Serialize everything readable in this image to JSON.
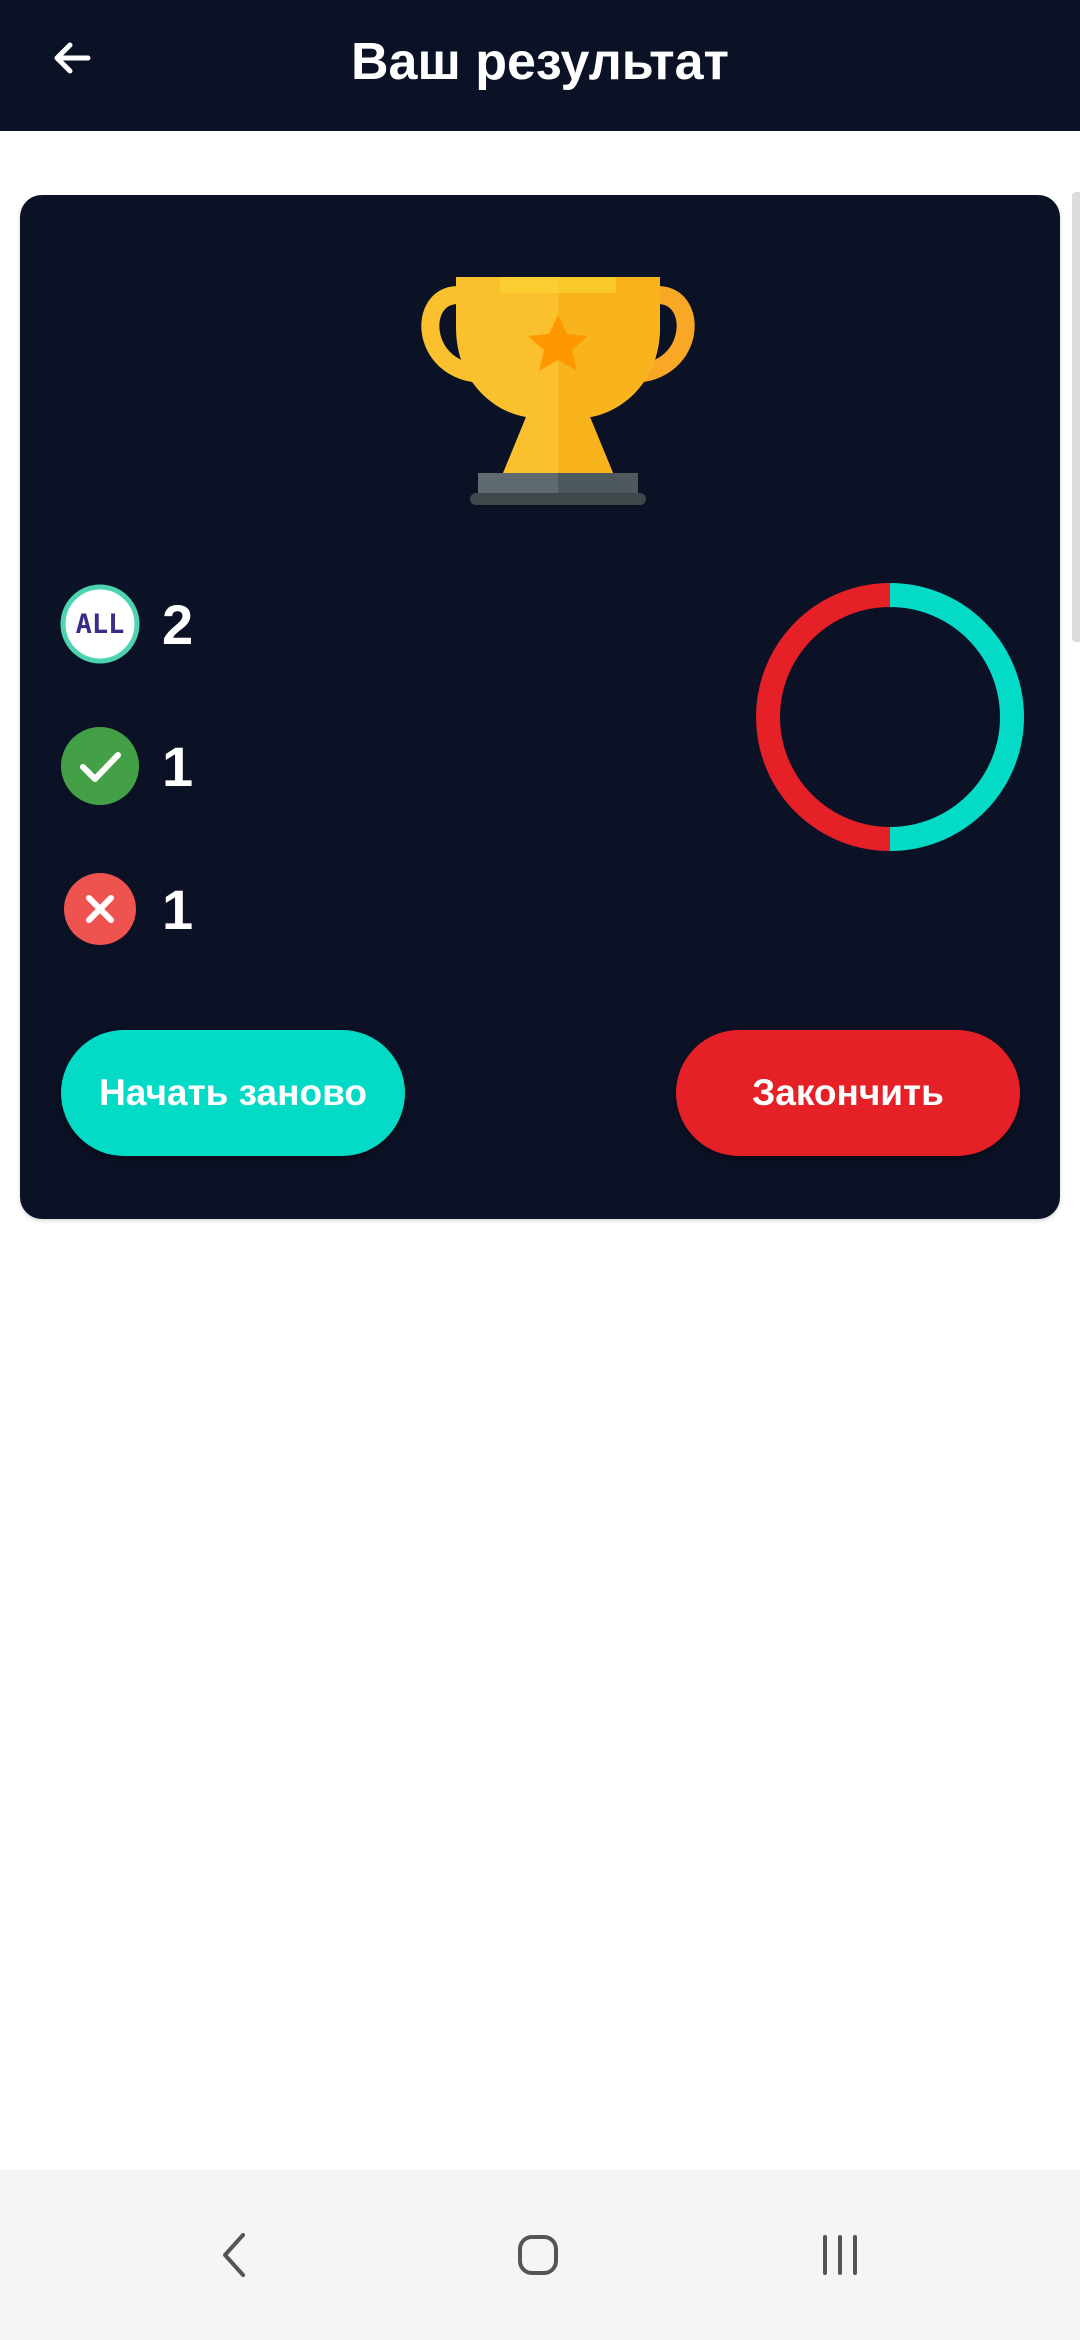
{
  "header": {
    "title": "Ваш результат",
    "back_icon": "arrow-left-icon"
  },
  "result": {
    "trophy_icon": "trophy-icon",
    "stats": [
      {
        "icon": "all-badge-icon",
        "badge_text": "ALL",
        "value": "2"
      },
      {
        "icon": "check-circle-icon",
        "value": "1"
      },
      {
        "icon": "x-circle-icon",
        "value": "1"
      }
    ],
    "chart_data": {
      "type": "pie",
      "style": "donut",
      "values": [
        1,
        1
      ],
      "colors": [
        "#03dbc7",
        "#e52026"
      ]
    }
  },
  "buttons": {
    "restart_label": "Начать заново",
    "finish_label": "Закончить"
  },
  "nav": {
    "back_icon": "nav-back-icon",
    "home_icon": "nav-home-icon",
    "recents_icon": "nav-recents-icon"
  },
  "colors": {
    "background_dark": "#0c1226",
    "accent_teal": "#03dbc7",
    "accent_red": "#e52026",
    "correct_green": "#43a047",
    "wrong_red": "#ef5350",
    "trophy_gold": "#fbc02d"
  }
}
